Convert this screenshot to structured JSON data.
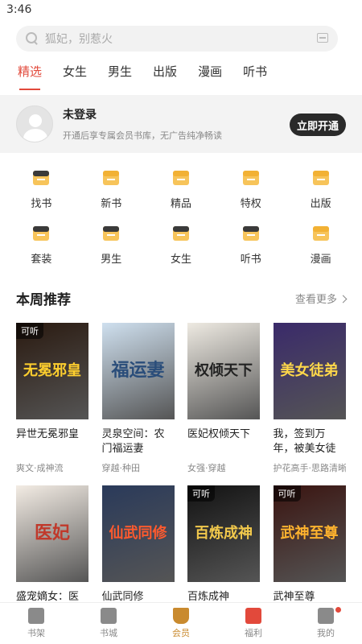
{
  "status": {
    "time": "3:46"
  },
  "search": {
    "placeholder": "狐妃，别惹火"
  },
  "tabs": [
    "精选",
    "女生",
    "男生",
    "出版",
    "漫画",
    "听书"
  ],
  "member": {
    "title": "未登录",
    "subtitle": "开通后享专属会员书库，无广告纯净畅读",
    "button": "立即开通"
  },
  "grid": [
    {
      "label": "找书",
      "icon": "find-book-icon"
    },
    {
      "label": "新书",
      "icon": "new-book-icon"
    },
    {
      "label": "精品",
      "icon": "premium-icon"
    },
    {
      "label": "特权",
      "icon": "crown-icon"
    },
    {
      "label": "出版",
      "icon": "publish-icon"
    },
    {
      "label": "套装",
      "icon": "gift-icon"
    },
    {
      "label": "男生",
      "icon": "male-icon"
    },
    {
      "label": "女生",
      "icon": "female-icon"
    },
    {
      "label": "听书",
      "icon": "headphones-icon"
    },
    {
      "label": "漫画",
      "icon": "comic-icon"
    }
  ],
  "section": {
    "title": "本周推荐",
    "more": "查看更多"
  },
  "books": [
    {
      "title": "异世无冕邪皇",
      "tags": "爽文·成神流",
      "badge": "可听",
      "cover_text": "无冕邪皇",
      "bg": "#2a1a10",
      "fg": "#ffcf2e"
    },
    {
      "title": "灵泉空间：农门福运妻",
      "tags": "穿越·种田",
      "badge": "",
      "cover_text": "福运妻",
      "bg": "#cfe0ef",
      "fg": "#2a4d7a"
    },
    {
      "title": "医妃权倾天下",
      "tags": "女强·穿越",
      "badge": "",
      "cover_text": "权倾天下",
      "bg": "#eeeae2",
      "fg": "#222222"
    },
    {
      "title": "我，签到万年，被美女徒弟曝光了",
      "tags": "护花高手·思路清晰",
      "badge": "",
      "cover_text": "美女徒弟",
      "bg": "#3a2a6a",
      "fg": "#ffd84a"
    },
    {
      "title": "盛宠嫡女：医妃不好惹",
      "tags": "",
      "badge": "",
      "cover_text": "医妃",
      "bg": "#f3ece4",
      "fg": "#c0392b"
    },
    {
      "title": "仙武同修",
      "tags": "",
      "badge": "",
      "cover_text": "仙武同修",
      "bg": "#2a3a5a",
      "fg": "#ff5a2e"
    },
    {
      "title": "百炼成神",
      "tags": "",
      "badge": "可听",
      "cover_text": "百炼成神",
      "bg": "#121212",
      "fg": "#f2c94c"
    },
    {
      "title": "武神至尊",
      "tags": "",
      "badge": "可听",
      "cover_text": "武神至尊",
      "bg": "#3a1410",
      "fg": "#ffb32e"
    }
  ],
  "nav": [
    {
      "label": "书架",
      "icon": "bookshelf-icon"
    },
    {
      "label": "书城",
      "icon": "bookstore-icon"
    },
    {
      "label": "会员",
      "icon": "vip-icon",
      "active": true
    },
    {
      "label": "福利",
      "icon": "welfare-icon"
    },
    {
      "label": "我的",
      "icon": "profile-icon"
    }
  ],
  "colors": {
    "accent": "#e2493b",
    "vip": "#c98a2e"
  }
}
